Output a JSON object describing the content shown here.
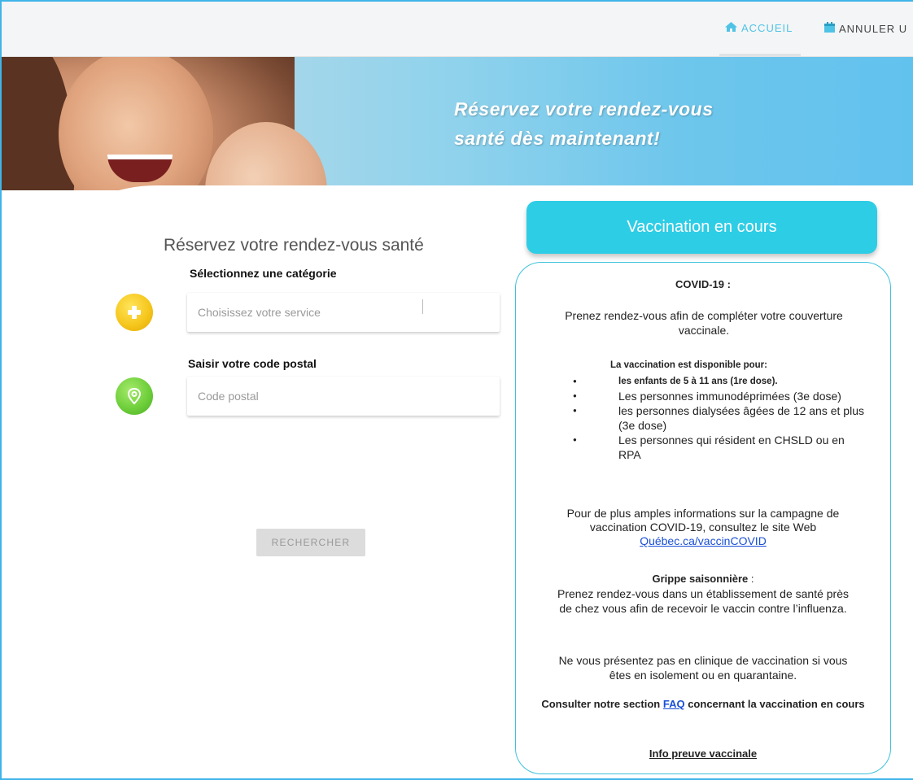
{
  "nav": {
    "accueil": "ACCUEIL",
    "annuler": "ANNULER U",
    "accueil_icon": "home-icon",
    "annuler_icon": "calendar-icon"
  },
  "banner": {
    "line1": "Réservez votre rendez-vous",
    "line2": "santé dès maintenant!"
  },
  "form": {
    "title": "Réservez votre rendez-vous santé",
    "category_label": "Sélectionnez une catégorie",
    "service_placeholder": "Choisissez votre service",
    "postal_label": "Saisir votre code postal",
    "postal_placeholder": "Code postal",
    "search_button": "RECHERCHER"
  },
  "panel": {
    "header": "Vaccination en cours",
    "covid_title": "COVID-19 :",
    "intro": "Prenez rendez-vous afin de compléter votre couverture vaccinale.",
    "available_title": "La vaccination est disponible pour:",
    "bullets": [
      "les enfants de 5 à 11 ans (1re dose).",
      "Les personnes immunodéprimées (3e dose)",
      "les personnes dialysées âgées de 12 ans et plus (3e dose)",
      "Les personnes qui résident en CHSLD ou en RPA"
    ],
    "more_info": "Pour de plus amples informations sur la campagne de vaccination COVID-19, consultez le site Web",
    "more_link": "Québec.ca/vaccinCOVID",
    "grippe_title": "Grippe saisonnière",
    "grippe_suffix": " :",
    "grippe_text": "Prenez rendez-vous dans un établissement de santé près de chez vous afin de recevoir le vaccin contre l’influenza.",
    "isolation": "Ne vous présentez pas en clinique de vaccination si vous êtes en isolement ou en quarantaine.",
    "faq_prefix": "Consulter notre section ",
    "faq_link": "FAQ",
    "faq_suffix": " concernant la vaccination en cours",
    "preuve": "Info preuve vaccinale"
  },
  "colors": {
    "accent": "#2ecde6",
    "border": "#3dc2dc",
    "link": "#1a4fd6"
  }
}
